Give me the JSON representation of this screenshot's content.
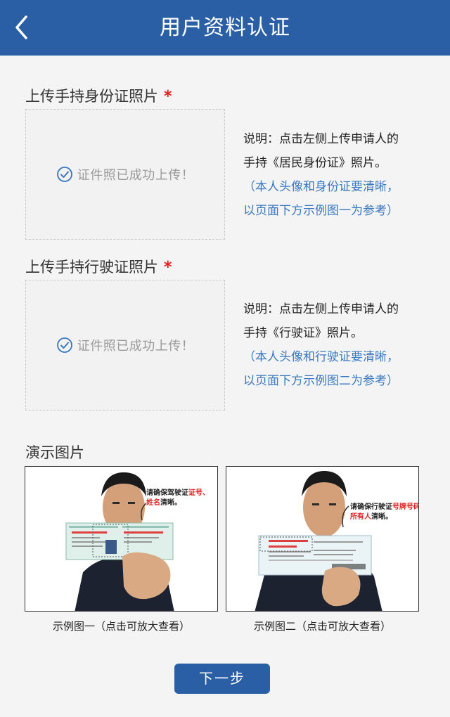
{
  "header": {
    "title": "用户资料认证",
    "back_icon": "chevron-left-icon"
  },
  "section1": {
    "label": "上传手持身份证照片",
    "required_mark": "*",
    "upload_status": "证件照已成功上传！",
    "note_line1": "说明：点击左侧上传申请人的",
    "note_line2": "手持《居民身份证》照片。",
    "note_line3": "（本人头像和身份证要清晰，",
    "note_line4": "以页面下方示例图一为参考）"
  },
  "section2": {
    "label": "上传手持行驶证照片",
    "required_mark": "*",
    "upload_status": "证件照已成功上传！",
    "note_line1": "说明：点击左侧上传申请人的",
    "note_line2": "手持《行驶证》照片。",
    "note_line3": "（本人头像和行驶证要清晰，",
    "note_line4": "以页面下方示例图二为参考）"
  },
  "demo": {
    "title": "演示图片",
    "example1": {
      "caption": "示例图一（点击可放大查看）",
      "annotation_line1_black": "请确保驾驶证",
      "annotation_line1_red": "证号、",
      "annotation_line2_red": "姓名",
      "annotation_line2_black": "清晰。"
    },
    "example2": {
      "caption": "示例图二（点击可放大查看）",
      "annotation_line1_black": "请确保行驶证",
      "annotation_line1_red": "号牌号码、",
      "annotation_line2_red": "所有人",
      "annotation_line2_black": "清晰。"
    }
  },
  "footer": {
    "next_label": "下一步"
  },
  "colors": {
    "brand": "#2a5fa5",
    "accent_blue": "#3a78c0",
    "required_red": "#e02020"
  }
}
